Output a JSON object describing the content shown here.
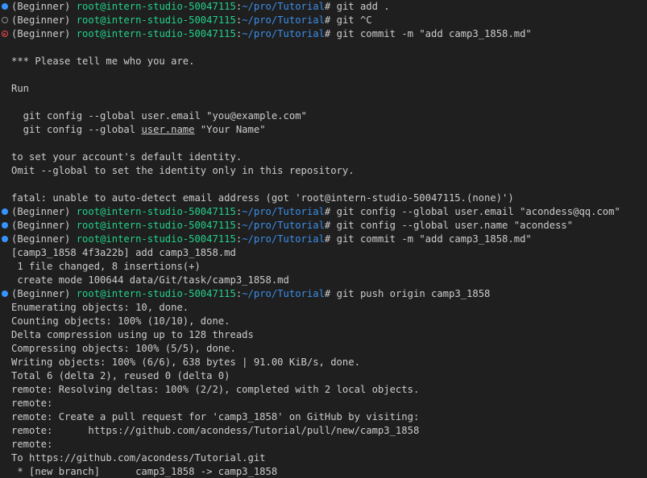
{
  "prompt": {
    "env": "(Beginner)",
    "userhost": "root@intern-studio-50047115",
    "path": "~/pro/Tutorial",
    "symbol": "#"
  },
  "colors": {
    "background": "#1f1f1f",
    "text": "#cccccc",
    "user": "#23d18b",
    "path": "#3b8eea",
    "success_dot": "#3794ff",
    "error_icon": "#f14c4c"
  },
  "lines": [
    {
      "type": "prompt",
      "deco": "success",
      "command": "git add ."
    },
    {
      "type": "prompt",
      "deco": "neutral",
      "command": "git ^C"
    },
    {
      "type": "prompt",
      "deco": "error",
      "command": "git commit -m \"add camp3_1858.md\""
    },
    {
      "type": "output",
      "text": ""
    },
    {
      "type": "output",
      "text": "*** Please tell me who you are."
    },
    {
      "type": "output",
      "text": ""
    },
    {
      "type": "output",
      "text": "Run"
    },
    {
      "type": "output",
      "text": ""
    },
    {
      "type": "output",
      "text": "  git config --global user.email \"you@example.com\""
    },
    {
      "type": "output_split",
      "before": "  git config --global ",
      "underlined": "user.name",
      "after": " \"Your Name\""
    },
    {
      "type": "output",
      "text": ""
    },
    {
      "type": "output",
      "text": "to set your account's default identity."
    },
    {
      "type": "output",
      "text": "Omit --global to set the identity only in this repository."
    },
    {
      "type": "output",
      "text": ""
    },
    {
      "type": "output",
      "text": "fatal: unable to auto-detect email address (got 'root@intern-studio-50047115.(none)')"
    },
    {
      "type": "prompt",
      "deco": "success",
      "command": "git config --global user.email \"acondess@qq.com\""
    },
    {
      "type": "prompt",
      "deco": "success",
      "command": "git config --global user.name \"acondess\""
    },
    {
      "type": "prompt",
      "deco": "success",
      "command": "git commit -m \"add camp3_1858.md\""
    },
    {
      "type": "output",
      "text": "[camp3_1858 4f3a22b] add camp3_1858.md"
    },
    {
      "type": "output",
      "text": " 1 file changed, 8 insertions(+)"
    },
    {
      "type": "output",
      "text": " create mode 100644 data/Git/task/camp3_1858.md"
    },
    {
      "type": "prompt",
      "deco": "success",
      "command": "git push origin camp3_1858"
    },
    {
      "type": "output",
      "text": "Enumerating objects: 10, done."
    },
    {
      "type": "output",
      "text": "Counting objects: 100% (10/10), done."
    },
    {
      "type": "output",
      "text": "Delta compression using up to 128 threads"
    },
    {
      "type": "output",
      "text": "Compressing objects: 100% (5/5), done."
    },
    {
      "type": "output",
      "text": "Writing objects: 100% (6/6), 638 bytes | 91.00 KiB/s, done."
    },
    {
      "type": "output",
      "text": "Total 6 (delta 2), reused 0 (delta 0)"
    },
    {
      "type": "output",
      "text": "remote: Resolving deltas: 100% (2/2), completed with 2 local objects."
    },
    {
      "type": "output",
      "text": "remote:"
    },
    {
      "type": "output",
      "text": "remote: Create a pull request for 'camp3_1858' on GitHub by visiting:"
    },
    {
      "type": "output",
      "text": "remote:      https://github.com/acondess/Tutorial/pull/new/camp3_1858"
    },
    {
      "type": "output",
      "text": "remote:"
    },
    {
      "type": "output",
      "text": "To https://github.com/acondess/Tutorial.git"
    },
    {
      "type": "output",
      "text": " * [new branch]      camp3_1858 -> camp3_1858"
    }
  ]
}
